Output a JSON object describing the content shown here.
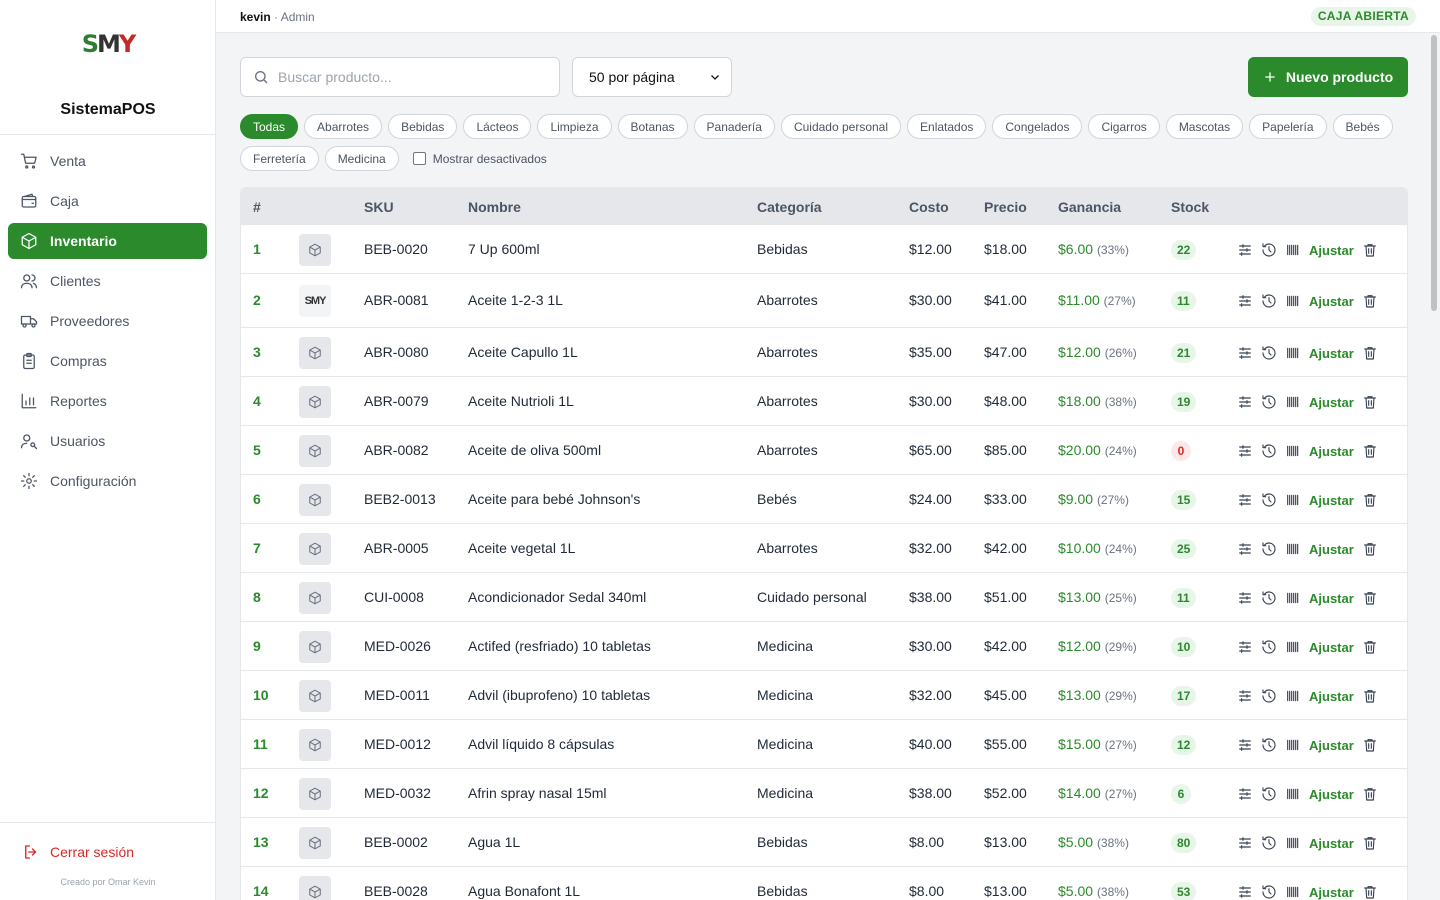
{
  "sidebar": {
    "logo_text": "SMY",
    "brand": "SistemaPOS",
    "items": [
      {
        "label": "Venta",
        "icon": "cart-icon",
        "active": false
      },
      {
        "label": "Caja",
        "icon": "wallet-icon",
        "active": false
      },
      {
        "label": "Inventario",
        "icon": "box-icon",
        "active": true
      },
      {
        "label": "Clientes",
        "icon": "users-icon",
        "active": false
      },
      {
        "label": "Proveedores",
        "icon": "truck-icon",
        "active": false
      },
      {
        "label": "Compras",
        "icon": "clipboard-icon",
        "active": false
      },
      {
        "label": "Reportes",
        "icon": "bar-chart-icon",
        "active": false
      },
      {
        "label": "Usuarios",
        "icon": "user-key-icon",
        "active": false
      },
      {
        "label": "Configuración",
        "icon": "gear-icon",
        "active": false
      }
    ],
    "logout": "Cerrar sesión",
    "credit": "Creado por Omar Kevin"
  },
  "topbar": {
    "user": "kevin",
    "sep": " · ",
    "role": "Admin",
    "status": "CAJA ABIERTA"
  },
  "toolbar": {
    "search_placeholder": "Buscar producto...",
    "per_page": "50 por página",
    "new_button": "Nuevo producto"
  },
  "categories": [
    "Todas",
    "Abarrotes",
    "Bebidas",
    "Lácteos",
    "Limpieza",
    "Botanas",
    "Panadería",
    "Cuidado personal",
    "Enlatados",
    "Congelados",
    "Cigarros",
    "Mascotas",
    "Papelería",
    "Bebés",
    "Ferretería",
    "Medicina"
  ],
  "active_category": "Todas",
  "show_disabled_label": "Mostrar desactivados",
  "table": {
    "headers": {
      "num": "#",
      "sku": "SKU",
      "name": "Nombre",
      "cat": "Categoría",
      "cost": "Costo",
      "price": "Precio",
      "gain": "Ganancia",
      "stock": "Stock"
    },
    "adjust_label": "Ajustar",
    "rows": [
      {
        "n": "1",
        "sku": "BEB-0020",
        "name": "7 Up 600ml",
        "cat": "Bebidas",
        "cost": "$12.00",
        "price": "$18.00",
        "gain": "$6.00",
        "pct": "(33%)",
        "stock": "22",
        "img": false
      },
      {
        "n": "2",
        "sku": "ABR-0081",
        "name": "Aceite 1-2-3 1L",
        "cat": "Abarrotes",
        "cost": "$30.00",
        "price": "$41.00",
        "gain": "$11.00",
        "pct": "(27%)",
        "stock": "11",
        "img": true
      },
      {
        "n": "3",
        "sku": "ABR-0080",
        "name": "Aceite Capullo 1L",
        "cat": "Abarrotes",
        "cost": "$35.00",
        "price": "$47.00",
        "gain": "$12.00",
        "pct": "(26%)",
        "stock": "21",
        "img": false
      },
      {
        "n": "4",
        "sku": "ABR-0079",
        "name": "Aceite Nutrioli 1L",
        "cat": "Abarrotes",
        "cost": "$30.00",
        "price": "$48.00",
        "gain": "$18.00",
        "pct": "(38%)",
        "stock": "19",
        "img": false
      },
      {
        "n": "5",
        "sku": "ABR-0082",
        "name": "Aceite de oliva 500ml",
        "cat": "Abarrotes",
        "cost": "$65.00",
        "price": "$85.00",
        "gain": "$20.00",
        "pct": "(24%)",
        "stock": "0",
        "img": false
      },
      {
        "n": "6",
        "sku": "BEB2-0013",
        "name": "Aceite para bebé Johnson's",
        "cat": "Bebés",
        "cost": "$24.00",
        "price": "$33.00",
        "gain": "$9.00",
        "pct": "(27%)",
        "stock": "15",
        "img": false
      },
      {
        "n": "7",
        "sku": "ABR-0005",
        "name": "Aceite vegetal 1L",
        "cat": "Abarrotes",
        "cost": "$32.00",
        "price": "$42.00",
        "gain": "$10.00",
        "pct": "(24%)",
        "stock": "25",
        "img": false
      },
      {
        "n": "8",
        "sku": "CUI-0008",
        "name": "Acondicionador Sedal 340ml",
        "cat": "Cuidado personal",
        "cost": "$38.00",
        "price": "$51.00",
        "gain": "$13.00",
        "pct": "(25%)",
        "stock": "11",
        "img": false
      },
      {
        "n": "9",
        "sku": "MED-0026",
        "name": "Actifed (resfriado) 10 tabletas",
        "cat": "Medicina",
        "cost": "$30.00",
        "price": "$42.00",
        "gain": "$12.00",
        "pct": "(29%)",
        "stock": "10",
        "img": false
      },
      {
        "n": "10",
        "sku": "MED-0011",
        "name": "Advil (ibuprofeno) 10 tabletas",
        "cat": "Medicina",
        "cost": "$32.00",
        "price": "$45.00",
        "gain": "$13.00",
        "pct": "(29%)",
        "stock": "17",
        "img": false
      },
      {
        "n": "11",
        "sku": "MED-0012",
        "name": "Advil líquido 8 cápsulas",
        "cat": "Medicina",
        "cost": "$40.00",
        "price": "$55.00",
        "gain": "$15.00",
        "pct": "(27%)",
        "stock": "12",
        "img": false
      },
      {
        "n": "12",
        "sku": "MED-0032",
        "name": "Afrin spray nasal 15ml",
        "cat": "Medicina",
        "cost": "$38.00",
        "price": "$52.00",
        "gain": "$14.00",
        "pct": "(27%)",
        "stock": "6",
        "img": false
      },
      {
        "n": "13",
        "sku": "BEB-0002",
        "name": "Agua 1L",
        "cat": "Bebidas",
        "cost": "$8.00",
        "price": "$13.00",
        "gain": "$5.00",
        "pct": "(38%)",
        "stock": "80",
        "img": false
      },
      {
        "n": "14",
        "sku": "BEB-0028",
        "name": "Agua Bonafont 1L",
        "cat": "Bebidas",
        "cost": "$8.00",
        "price": "$13.00",
        "gain": "$5.00",
        "pct": "(38%)",
        "stock": "53",
        "img": false
      }
    ]
  }
}
